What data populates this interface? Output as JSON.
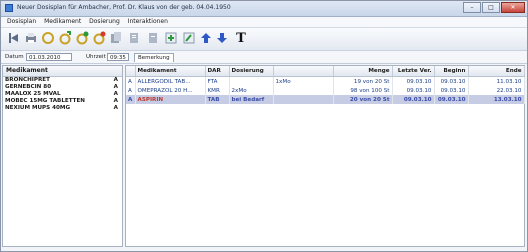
{
  "window": {
    "title": "Neuer Dosisplan für Ambacher, Prof. Dr. Klaus von der geb. 04.04.1950",
    "buttons": [
      "–",
      "□",
      "✕"
    ]
  },
  "menu": [
    "Dosisplan",
    "Medikament",
    "Dosierung",
    "Interaktionen"
  ],
  "toolbar_icons": [
    "open-icon",
    "print-icon",
    "dose-icon",
    "dose-add-icon",
    "dose-remove-icon",
    "dose-edit-icon",
    "copy-icon",
    "document-icon",
    "green-plus-icon",
    "edit-icon",
    "arrow-up-icon",
    "arrow-down-icon",
    "text-icon"
  ],
  "datebar": {
    "date_label": "Datum",
    "date_value": "01.03.2010",
    "time_label": "Uhrzeit",
    "time_value": "09:35",
    "tab_label": "Bemerkung"
  },
  "left_panel": {
    "header": "Medikament",
    "items": [
      {
        "name": "BRONCHIPRET",
        "flag": "A"
      },
      {
        "name": "GERNEBCIN 80",
        "flag": "A"
      },
      {
        "name": "MAALOX 25 MVAL",
        "flag": "A"
      },
      {
        "name": "MOBEC 15MG TABLETTEN",
        "flag": "A"
      },
      {
        "name": "NEXIUM MUPS 40MG",
        "flag": "A"
      }
    ]
  },
  "table": {
    "headers": [
      "",
      "Medikament",
      "DAR",
      "Dosierung",
      "",
      "Menge",
      "Letzte Ver.",
      "Beginn",
      "Ende"
    ],
    "rows": [
      [
        "A",
        "ALLERGODIL TAB...",
        "FTA",
        "",
        "1xMo",
        "19 von 20 St",
        "09.03.10",
        "09.03.10",
        "11.03.10"
      ],
      [
        "A",
        "OMEPRAZOL 20 H...",
        "KMR",
        "2xMo",
        "",
        "98 von 100 St",
        "09.03.10",
        "09.03.10",
        "22.03.10"
      ],
      [
        "A",
        "ASPIRIN",
        "TAB",
        "bei Bedarf",
        "",
        "20 von 20 St",
        "09.03.10",
        "09.03.10",
        "13.03.10"
      ]
    ]
  }
}
